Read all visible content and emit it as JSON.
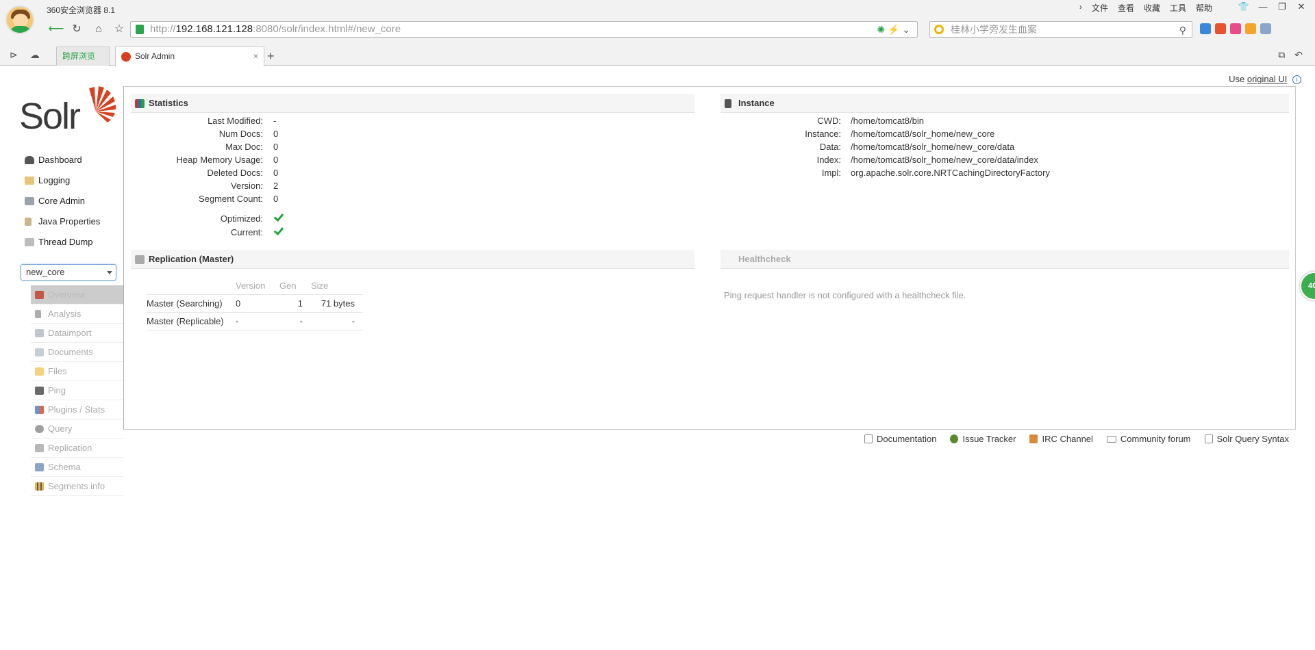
{
  "browser": {
    "name": "360安全浏览器 8.1",
    "menu": [
      "文件",
      "查看",
      "收藏",
      "工具",
      "帮助"
    ],
    "address": {
      "prefix": "http://",
      "host": "192.168.121.128",
      "rest": ":8080/solr/index.html#/new_core"
    },
    "search_placeholder": "桂林小学旁发生血案",
    "tabs": [
      {
        "label": "跨屏浏览"
      },
      {
        "label": "Solr Admin"
      }
    ],
    "float_badge": "46"
  },
  "page": {
    "use_original": {
      "prefix": "Use",
      "link": "original UI"
    },
    "logo": "Solr",
    "nav": [
      "Dashboard",
      "Logging",
      "Core Admin",
      "Java Properties",
      "Thread Dump"
    ],
    "core_selected": "new_core",
    "core_menu": [
      "Overview",
      "Analysis",
      "Dataimport",
      "Documents",
      "Files",
      "Ping",
      "Plugins / Stats",
      "Query",
      "Replication",
      "Schema",
      "Segments info"
    ],
    "statistics": {
      "title": "Statistics",
      "rows": [
        {
          "k": "Last Modified:",
          "v": "-"
        },
        {
          "k": "Num Docs:",
          "v": "0"
        },
        {
          "k": "Max Doc:",
          "v": "0"
        },
        {
          "k": "Heap Memory Usage:",
          "v": "0"
        },
        {
          "k": "Deleted Docs:",
          "v": "0"
        },
        {
          "k": "Version:",
          "v": "2"
        },
        {
          "k": "Segment Count:",
          "v": "0"
        }
      ],
      "flags": [
        {
          "k": "Optimized:",
          "checked": true
        },
        {
          "k": "Current:",
          "checked": true
        }
      ]
    },
    "instance": {
      "title": "Instance",
      "rows": [
        {
          "k": "CWD:",
          "v": "/home/tomcat8/bin"
        },
        {
          "k": "Instance:",
          "v": "/home/tomcat8/solr_home/new_core"
        },
        {
          "k": "Data:",
          "v": "/home/tomcat8/solr_home/new_core/data"
        },
        {
          "k": "Index:",
          "v": "/home/tomcat8/solr_home/new_core/data/index"
        },
        {
          "k": "Impl:",
          "v": "org.apache.solr.core.NRTCachingDirectoryFactory"
        }
      ]
    },
    "replication": {
      "title": "Replication (Master)",
      "headers": [
        "",
        "Version",
        "Gen",
        "Size"
      ],
      "rows": [
        [
          "Master (Searching)",
          "0",
          "1",
          "71 bytes"
        ],
        [
          "Master (Replicable)",
          "-",
          "-",
          "-"
        ]
      ]
    },
    "healthcheck": {
      "title": "Healthcheck",
      "message": "Ping request handler is not configured with a healthcheck file."
    },
    "footer": [
      "Documentation",
      "Issue Tracker",
      "IRC Channel",
      "Community forum",
      "Solr Query Syntax"
    ]
  }
}
